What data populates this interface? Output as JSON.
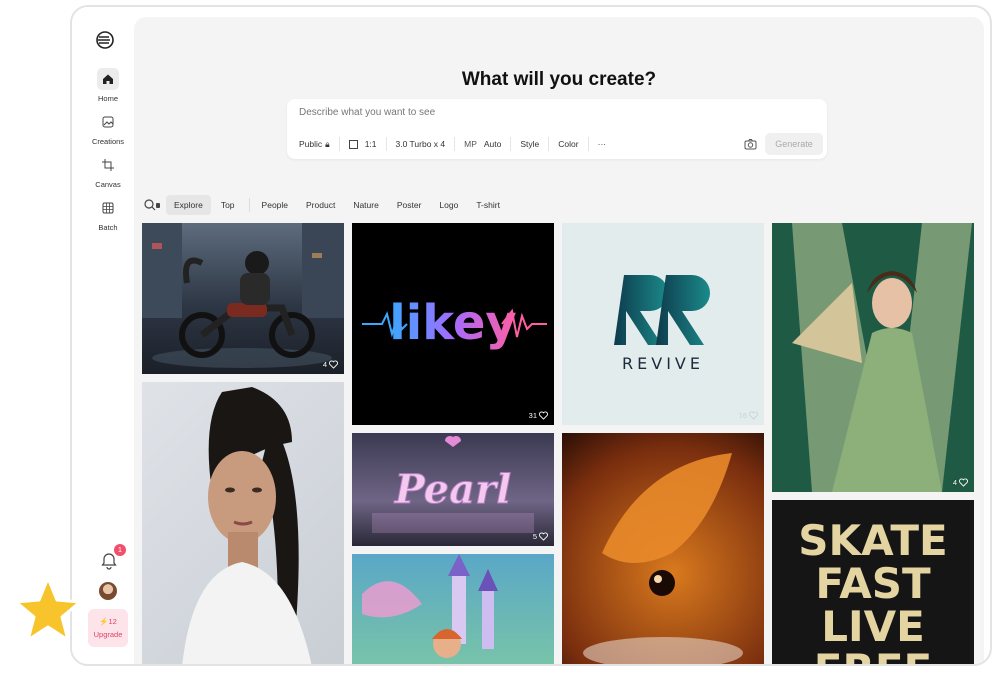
{
  "sidebar": {
    "items": [
      {
        "label": "Home",
        "icon": "home-icon",
        "active": true
      },
      {
        "label": "Creations",
        "icon": "image-icon",
        "active": false
      },
      {
        "label": "Canvas",
        "icon": "crop-icon",
        "active": false
      },
      {
        "label": "Batch",
        "icon": "grid-icon",
        "active": false
      }
    ],
    "notification_count": "1",
    "upgrade": {
      "credits": "12",
      "label": "Upgrade"
    }
  },
  "main": {
    "headline": "What will you create?",
    "prompt": {
      "placeholder": "Describe what you want to see",
      "visibility": "Public",
      "ratio": "1:1",
      "model": "3.0 Turbo x 4",
      "mp_label": "MP",
      "mp_value": "Auto",
      "style": "Style",
      "color": "Color",
      "more": "···",
      "generate": "Generate"
    },
    "tabs": [
      "Explore",
      "Top",
      "People",
      "Product",
      "Nature",
      "Poster",
      "Logo",
      "T-shirt"
    ],
    "active_tab": "Explore"
  },
  "gallery": [
    {
      "subject": "cat riding motorcycle",
      "likes": "4"
    },
    {
      "subject": "portrait woman",
      "likes": ""
    },
    {
      "subject": "likey logo",
      "text": "likey",
      "likes": "31"
    },
    {
      "subject": "pearl 3d text",
      "text": "Pearl",
      "likes": "5"
    },
    {
      "subject": "fairy castle",
      "likes": ""
    },
    {
      "subject": "revive logo",
      "text": "REVIVE",
      "likes": "16"
    },
    {
      "subject": "macro orange leaf",
      "likes": ""
    },
    {
      "subject": "vintage woman with fan",
      "likes": "4"
    },
    {
      "subject": "skate poster",
      "text": "SKATE FAST LIVE FREE",
      "likes": ""
    }
  ],
  "colors": {
    "accent": "#f0506a",
    "star": "#f7c52b"
  }
}
